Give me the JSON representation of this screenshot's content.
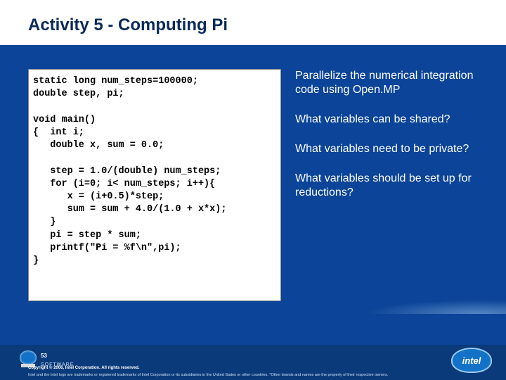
{
  "title": "Activity 5 - Computing Pi",
  "code": "static long num_steps=100000;\ndouble step, pi;\n\nvoid main()\n{  int i;\n   double x, sum = 0.0;\n\n   step = 1.0/(double) num_steps;\n   for (i=0; i< num_steps; i++){\n      x = (i+0.5)*step;\n      sum = sum + 4.0/(1.0 + x*x);\n   }\n   pi = step * sum;\n   printf(\"Pi = %f\\n\",pi);\n}",
  "notes": {
    "p1": "Parallelize the numerical integration code using Open.MP",
    "p2": "What variables can be shared?",
    "p3": "What variables need to be private?",
    "p4": "What variables should be set up for reductions?"
  },
  "footer": {
    "page": "53",
    "copyright": "Copyright © 2006, Intel Corporation. All rights reserved.",
    "trademark": "Intel and the Intel logo are trademarks or registered trademarks of Intel Corporation or its subsidiaries in the United States or other countries. *Other brands and names are the property of their respective owners.",
    "software": "SOFTWARE",
    "badge": "intel"
  }
}
